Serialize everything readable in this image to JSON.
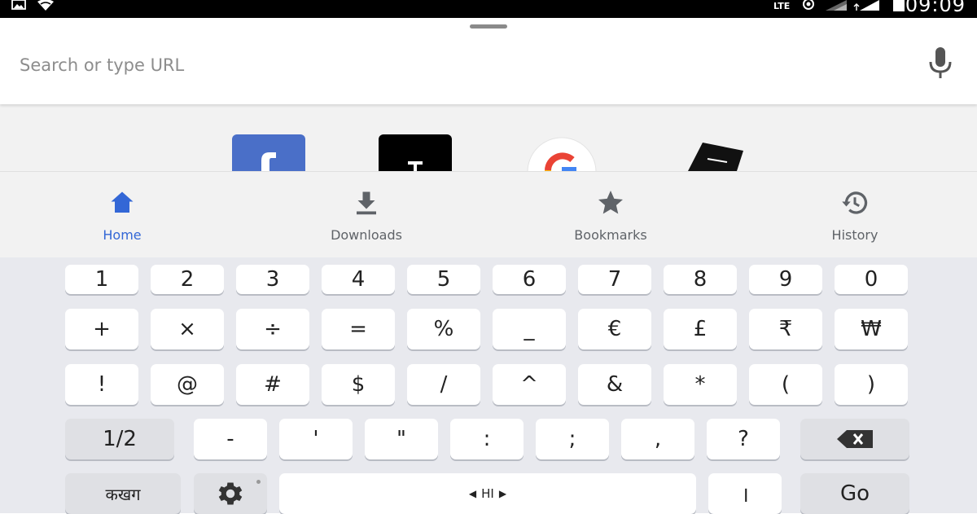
{
  "status_bar": {
    "network": "LTE",
    "time": "09:09"
  },
  "omnibox": {
    "placeholder": "Search or type URL",
    "value": ""
  },
  "tiles": [
    {
      "name": "facebook-tile",
      "icon": "facebook-logo",
      "color": "#4a6fc8"
    },
    {
      "name": "tumblr-tile",
      "icon": "tumblr-logo",
      "color": "#000000"
    },
    {
      "name": "google-tile",
      "icon": "google-logo",
      "color": "#ffffff"
    },
    {
      "name": "android-police-tile",
      "icon": "android-police-logo",
      "color": "#000000"
    }
  ],
  "nav": {
    "active": "home",
    "active_color": "#3367d6",
    "items": [
      {
        "id": "home",
        "label": "Home",
        "icon": "home-icon"
      },
      {
        "id": "downloads",
        "label": "Downloads",
        "icon": "download-icon"
      },
      {
        "id": "bookmarks",
        "label": "Bookmarks",
        "icon": "star-icon"
      },
      {
        "id": "history",
        "label": "History",
        "icon": "history-icon"
      }
    ]
  },
  "keyboard": {
    "row1": [
      "1",
      "2",
      "3",
      "4",
      "5",
      "6",
      "7",
      "8",
      "9",
      "0"
    ],
    "row2": [
      "+",
      "×",
      "÷",
      "=",
      "%",
      "_",
      "€",
      "£",
      "₹",
      "₩"
    ],
    "row3": [
      "!",
      "@",
      "#",
      "$",
      "/",
      "^",
      "&",
      "*",
      "(",
      ")"
    ],
    "row4": {
      "page_toggle": "1/2",
      "keys": [
        "-",
        "'",
        "\"",
        ":",
        ";",
        ",",
        "?"
      ],
      "backspace_icon": "backspace-icon"
    },
    "row5": {
      "lang_key": "कखग",
      "settings_icon": "gear-icon",
      "space_label": "HI",
      "period": "।",
      "go": "Go"
    }
  }
}
